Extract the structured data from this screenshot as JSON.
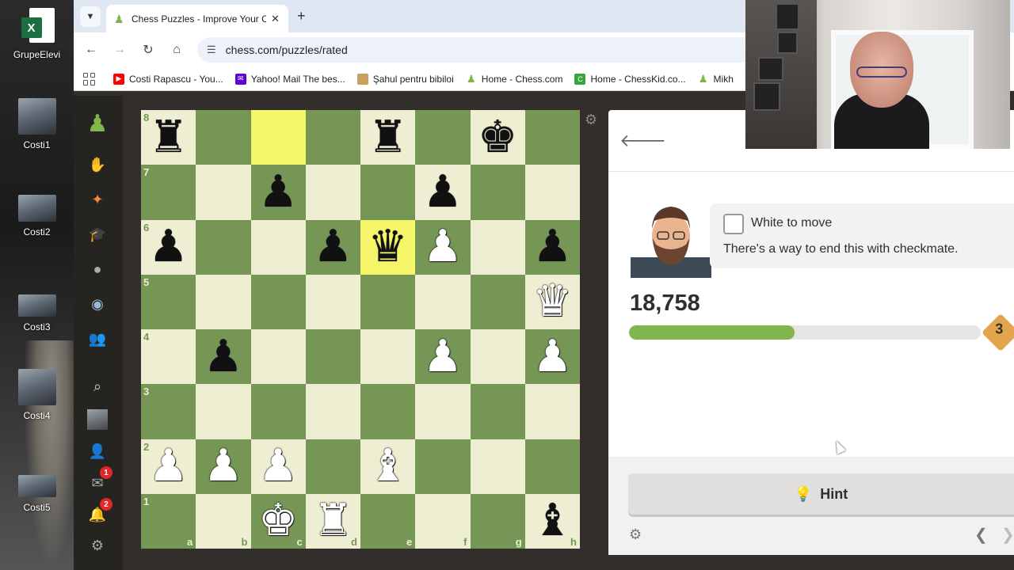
{
  "desktop": {
    "icons": [
      {
        "label": "GrupeElevi",
        "icon": "excel-icon"
      },
      {
        "label": "Costi1",
        "icon": "video-thumbnail"
      },
      {
        "label": "Costi2",
        "icon": "video-thumbnail"
      },
      {
        "label": "Costi3",
        "icon": "video-thumbnail"
      },
      {
        "label": "Costi4",
        "icon": "video-thumbnail"
      },
      {
        "label": "Costi5",
        "icon": "video-thumbnail"
      }
    ]
  },
  "browser": {
    "tab_title": "Chess Puzzles - Improve Your C",
    "url": "chess.com/puzzles/rated",
    "bookmarks": [
      {
        "label": "Costi Rapascu - You...",
        "color": "#ff0000"
      },
      {
        "label": "Yahoo! Mail The bes...",
        "color": "#6001d2"
      },
      {
        "label": "Şahul pentru bibiloi",
        "color": "#c8a060"
      },
      {
        "label": "Home - Chess.com",
        "color": "#81b64c"
      },
      {
        "label": "Home - ChessKid.co...",
        "color": "#3aa63a"
      },
      {
        "label": "Mikh",
        "color": "#81b64c"
      }
    ]
  },
  "sidenav": {
    "mail_badge": "1",
    "notif_badge": "2"
  },
  "board": {
    "ranks": [
      "8",
      "7",
      "6",
      "5",
      "4",
      "3",
      "2",
      "1"
    ],
    "files": [
      "a",
      "b",
      "c",
      "d",
      "e",
      "f",
      "g",
      "h"
    ],
    "position": [
      [
        "bR",
        "",
        "",
        "",
        "bR",
        "",
        "bK",
        ""
      ],
      [
        "",
        "",
        "bP",
        "",
        "",
        "bP",
        "",
        ""
      ],
      [
        "bP",
        "",
        "",
        "bP",
        "bQ",
        "wP",
        "",
        "bP"
      ],
      [
        "",
        "",
        "",
        "",
        "",
        "",
        "",
        "wQ"
      ],
      [
        "",
        "bP",
        "",
        "",
        "",
        "wP",
        "",
        "wP"
      ],
      [
        "",
        "",
        "",
        "",
        "",
        "",
        "",
        ""
      ],
      [
        "wP",
        "wP",
        "wP",
        "",
        "wB",
        "",
        "",
        ""
      ],
      [
        "",
        "",
        "wK",
        "wR",
        "",
        "",
        "",
        "bB"
      ]
    ],
    "highlighted": [
      "c8",
      "e6"
    ]
  },
  "panel": {
    "to_move": "White to move",
    "description": "There's a way to end this with checkmate.",
    "rating": "18,758",
    "progress_fraction": 0.47,
    "streak": "3",
    "hint_label": "Hint"
  }
}
